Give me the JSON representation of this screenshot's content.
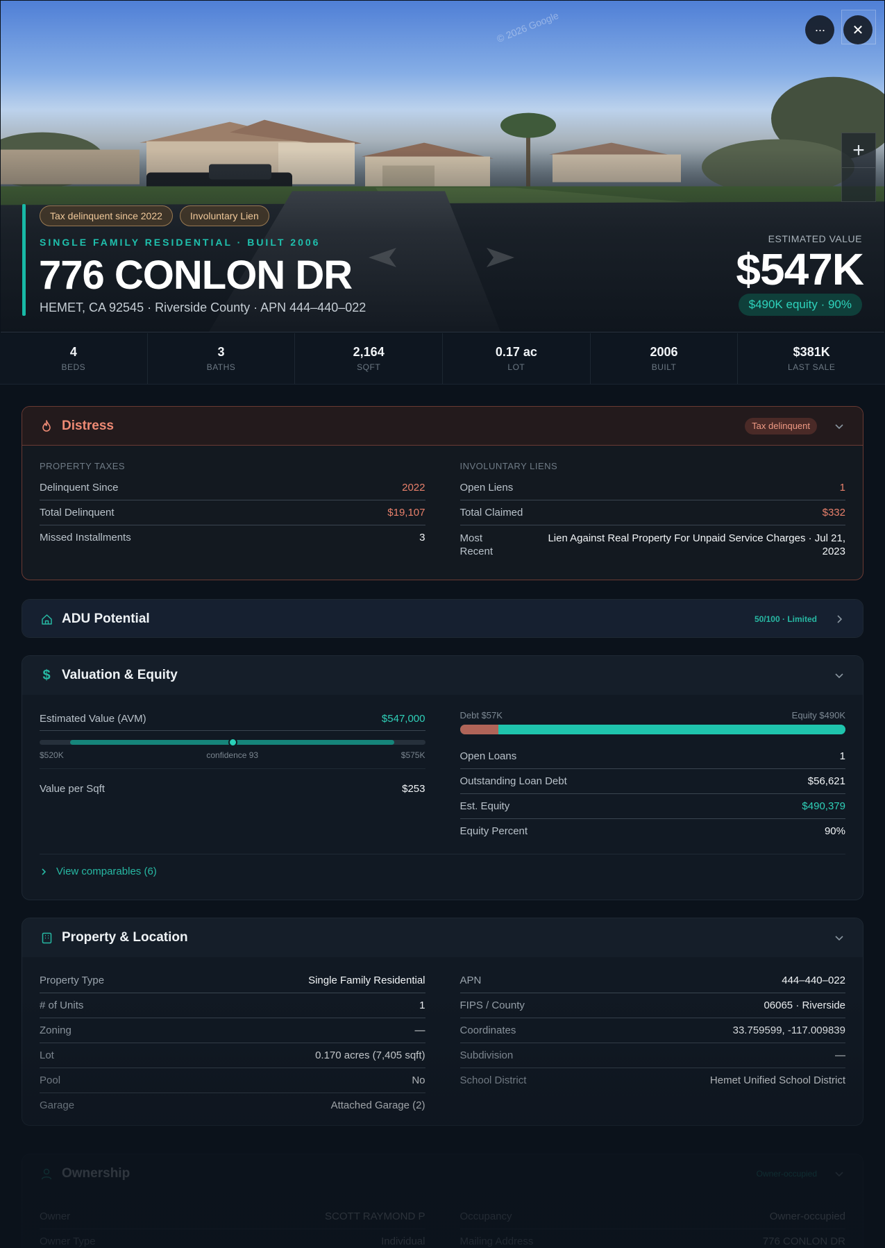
{
  "hero": {
    "watermark": "© 2026 Google",
    "tags": [
      "Tax delinquent since 2022",
      "Involuntary Lien"
    ],
    "subtitle": "SINGLE FAMILY RESIDENTIAL · BUILT 2006",
    "title": "776 CONLON DR",
    "address": "HEMET, CA 92545 · Riverside County · APN 444–440–022",
    "estimated_label": "ESTIMATED VALUE",
    "estimated_value": "$547K",
    "equity_pill": "$490K equity · 90%",
    "zoom_plus": "+",
    "more": "···",
    "close": "✕"
  },
  "stats": [
    {
      "value": "4",
      "label": "BEDS"
    },
    {
      "value": "3",
      "label": "BATHS"
    },
    {
      "value": "2,164",
      "label": "SQFT"
    },
    {
      "value": "0.17 ac",
      "label": "LOT"
    },
    {
      "value": "2006",
      "label": "BUILT"
    },
    {
      "value": "$381K",
      "label": "LAST SALE"
    }
  ],
  "distress": {
    "title": "Distress",
    "badge": "Tax delinquent",
    "taxes_label": "PROPERTY TAXES",
    "taxes": [
      {
        "k": "Delinquent Since",
        "v": "2022"
      },
      {
        "k": "Total Delinquent",
        "v": "$19,107"
      },
      {
        "k": "Missed Installments",
        "v": "3"
      }
    ],
    "liens_label": "INVOLUNTARY LIENS",
    "liens": [
      {
        "k": "Open Liens",
        "v": "1"
      },
      {
        "k": "Total Claimed",
        "v": "$332"
      },
      {
        "k": "Most Recent",
        "v": "Lien Against Real Property For Unpaid Service Charges · Jul 21, 2023"
      }
    ]
  },
  "adu": {
    "title": "ADU Potential",
    "score": "50/100 · Limited"
  },
  "valuation": {
    "title": "Valuation & Equity",
    "avm_label": "Estimated Value (AVM)",
    "avm_value": "$547,000",
    "range_low": "$520K",
    "confidence": "confidence 93",
    "range_high": "$575K",
    "range_position": 0.5,
    "vps_label": "Value per Sqft",
    "vps_value": "$253",
    "debt_label": "Debt $57K",
    "equity_label": "Equity $490K",
    "debt_fraction": 0.1,
    "rows": [
      {
        "k": "Open Loans",
        "v": "1"
      },
      {
        "k": "Outstanding Loan Debt",
        "v": "$56,621"
      },
      {
        "k": "Est. Equity",
        "v": "$490,379"
      },
      {
        "k": "Equity Percent",
        "v": "90%"
      }
    ],
    "comps": "View comparables (6)"
  },
  "property": {
    "title": "Property & Location",
    "left": [
      {
        "k": "Property Type",
        "v": "Single Family Residential"
      },
      {
        "k": "# of Units",
        "v": "1"
      },
      {
        "k": "Zoning",
        "v": "—"
      },
      {
        "k": "Lot",
        "v": "0.170 acres (7,405 sqft)"
      },
      {
        "k": "Pool",
        "v": "No"
      },
      {
        "k": "Garage",
        "v": "Attached Garage (2)"
      }
    ],
    "right": [
      {
        "k": "APN",
        "v": "444–440–022"
      },
      {
        "k": "FIPS / County",
        "v": "06065 · Riverside"
      },
      {
        "k": "Coordinates",
        "v": "33.759599, -117.009839"
      },
      {
        "k": "Subdivision",
        "v": "—"
      },
      {
        "k": "School District",
        "v": "Hemet Unified School District"
      }
    ]
  },
  "ownership": {
    "title": "Ownership",
    "badge": "Owner-occupied",
    "left": [
      {
        "k": "Owner",
        "v": "SCOTT RAYMOND P"
      },
      {
        "k": "Owner Type",
        "v": "Individual"
      }
    ],
    "right": [
      {
        "k": "Occupancy",
        "v": "Owner-occupied"
      },
      {
        "k": "Mailing Address",
        "v": "776 CONLON DR"
      }
    ]
  },
  "colors": {
    "accent": "#18b9a6",
    "danger": "#e8806b",
    "background": "#0b121b"
  }
}
